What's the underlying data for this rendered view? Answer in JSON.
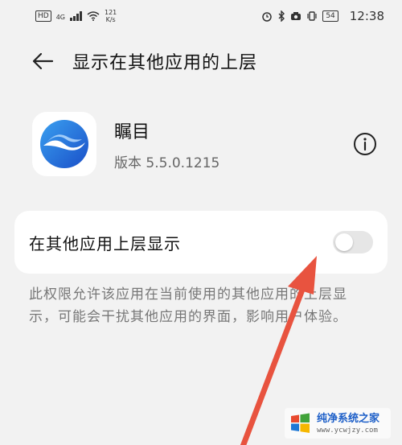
{
  "status_bar": {
    "hd_badge": "HD",
    "net_type": "4G",
    "net_speed_value": "121",
    "net_speed_unit": "K/s",
    "battery": "54",
    "time": "12:38"
  },
  "app_bar": {
    "title": "显示在其他应用的上层"
  },
  "app": {
    "name": "瞩目",
    "version": "版本 5.5.0.1215"
  },
  "setting": {
    "label": "在其他应用上层显示",
    "enabled": false
  },
  "description": "此权限允许该应用在当前使用的其他应用的上层显示，可能会干扰其他应用的界面，影响用户体验。",
  "watermark": {
    "title": "纯净系统之家",
    "url": "www.ycwjzy.com"
  },
  "colors": {
    "background": "#f2f2f2",
    "card": "#ffffff",
    "arrow": "#e8533f",
    "app_icon_blue": "#1a63d6"
  }
}
